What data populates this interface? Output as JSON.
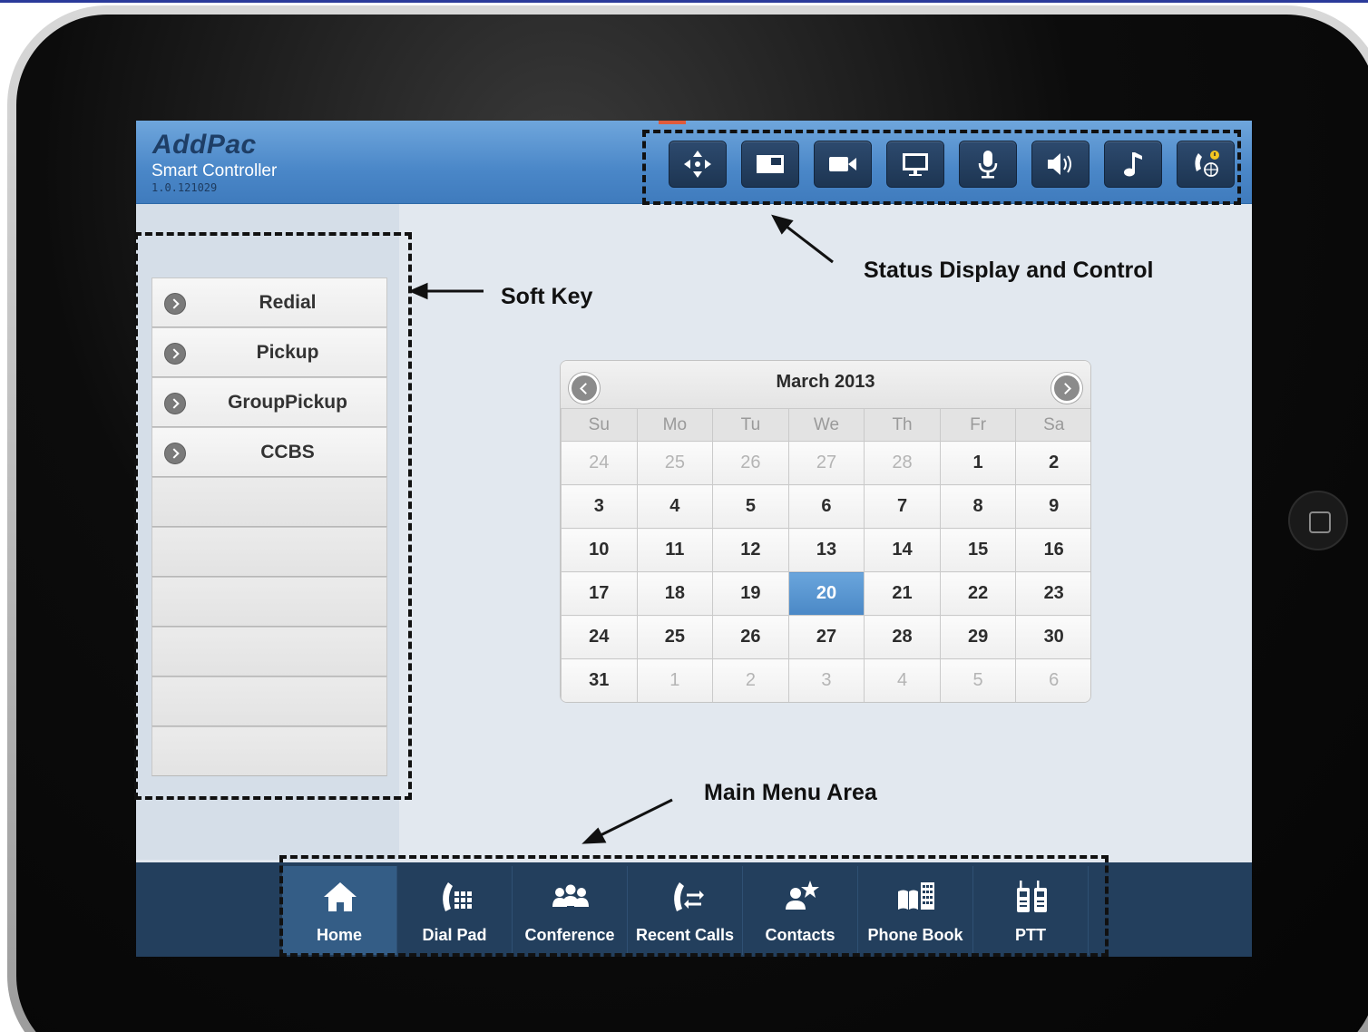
{
  "app": {
    "brand": "AddPac",
    "subtitle": "Smart Controller",
    "version": "1.0.121029"
  },
  "status_controls": [
    {
      "icon": "move-arrows-icon"
    },
    {
      "icon": "picture-in-picture-icon"
    },
    {
      "icon": "video-camera-icon"
    },
    {
      "icon": "monitor-icon"
    },
    {
      "icon": "microphone-icon"
    },
    {
      "icon": "speaker-icon"
    },
    {
      "icon": "music-note-icon"
    },
    {
      "icon": "call-status-icon"
    }
  ],
  "softkeys": {
    "items": [
      "Redial",
      "Pickup",
      "GroupPickup",
      "CCBS",
      "",
      "",
      "",
      "",
      "",
      ""
    ]
  },
  "calendar": {
    "title": "March 2013",
    "weekdays": [
      "Su",
      "Mo",
      "Tu",
      "We",
      "Th",
      "Fr",
      "Sa"
    ],
    "weeks": [
      [
        "24",
        "25",
        "26",
        "27",
        "28",
        "1",
        "2"
      ],
      [
        "3",
        "4",
        "5",
        "6",
        "7",
        "8",
        "9"
      ],
      [
        "10",
        "11",
        "12",
        "13",
        "14",
        "15",
        "16"
      ],
      [
        "17",
        "18",
        "19",
        "20",
        "21",
        "22",
        "23"
      ],
      [
        "24",
        "25",
        "26",
        "27",
        "28",
        "29",
        "30"
      ],
      [
        "31",
        "1",
        "2",
        "3",
        "4",
        "5",
        "6"
      ]
    ],
    "selected_day": "20"
  },
  "bottom_nav": {
    "tabs": [
      {
        "label": "Home",
        "icon": "home-icon",
        "active": true
      },
      {
        "label": "Dial Pad",
        "icon": "dial-pad-icon",
        "active": false
      },
      {
        "label": "Conference",
        "icon": "conference-icon",
        "active": false
      },
      {
        "label": "Recent Calls",
        "icon": "recent-calls-icon",
        "active": false
      },
      {
        "label": "Contacts",
        "icon": "contacts-icon",
        "active": false
      },
      {
        "label": "Phone Book",
        "icon": "phone-book-icon",
        "active": false
      },
      {
        "label": "PTT",
        "icon": "ptt-icon",
        "active": false
      }
    ]
  },
  "annotations": {
    "status": "Status Display and Control",
    "softkey": "Soft Key",
    "mainmenu": "Main Menu Area"
  },
  "colors": {
    "header_blue": "#4a87c8",
    "nav_dark": "#233f5d",
    "selected_day": "#4a88c6"
  }
}
